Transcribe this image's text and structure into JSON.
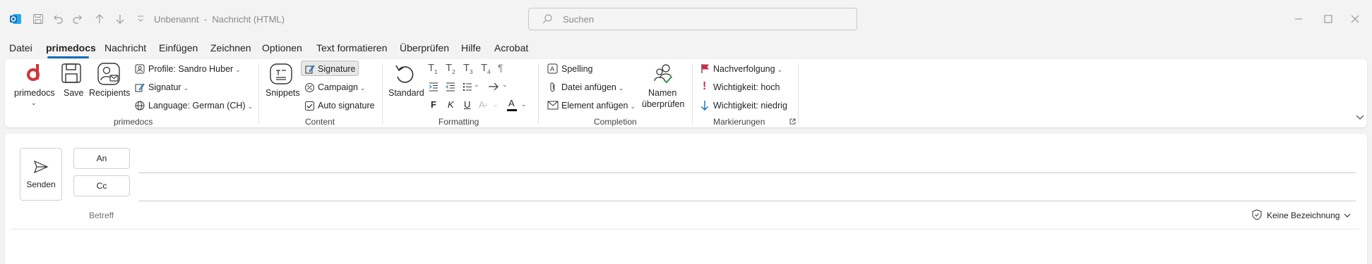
{
  "window": {
    "doc_title": "Unbenannt  -  Nachricht (HTML)",
    "search_placeholder": "Suchen"
  },
  "tabs": [
    "Datei",
    "primedocs",
    "Nachricht",
    "Einfügen",
    "Zeichnen",
    "Optionen",
    "Text formatieren",
    "Überprüfen",
    "Hilfe",
    "Acrobat"
  ],
  "active_tab": "primedocs",
  "ribbon": {
    "primedocs_group": {
      "label": "primedocs",
      "primedocs_button": "primedocs",
      "save_button": "Save",
      "recipients_button": "Recipients",
      "profile": "Profile: Sandro Huber",
      "signatur": "Signatur",
      "language": "Language: German (CH)"
    },
    "content_group": {
      "label": "Content",
      "snippets": "Snippets",
      "signature": "Signature",
      "campaign": "Campaign",
      "auto_signature": "Auto signature"
    },
    "formatting_group": {
      "label": "Formatting",
      "standard": "Standard",
      "bold": "F",
      "italic": "K",
      "underline": "U",
      "font_color": "A"
    },
    "completion_group": {
      "label": "Completion",
      "spelling": "Spelling",
      "datei_anfuegen": "Datei anfügen",
      "element_anfuegen": "Element anfügen",
      "namen_1": "Namen",
      "namen_2": "überprüfen"
    },
    "markierungen_group": {
      "label": "Markierungen",
      "nachverfolgung": "Nachverfolgung",
      "wichtigkeit_hoch": "Wichtigkeit: hoch",
      "wichtigkeit_niedrig": "Wichtigkeit: niedrig"
    }
  },
  "compose": {
    "send": "Senden",
    "to": "An",
    "cc": "Cc",
    "subject": "Betreff",
    "sensitivity": "Keine Bezeichnung"
  },
  "colors": {
    "accent": "#0f6cbd",
    "primedocs_red": "#d13438",
    "flag_red": "#c4314b",
    "importance_high": "#c4314b",
    "importance_low": "#0f6cbd"
  }
}
